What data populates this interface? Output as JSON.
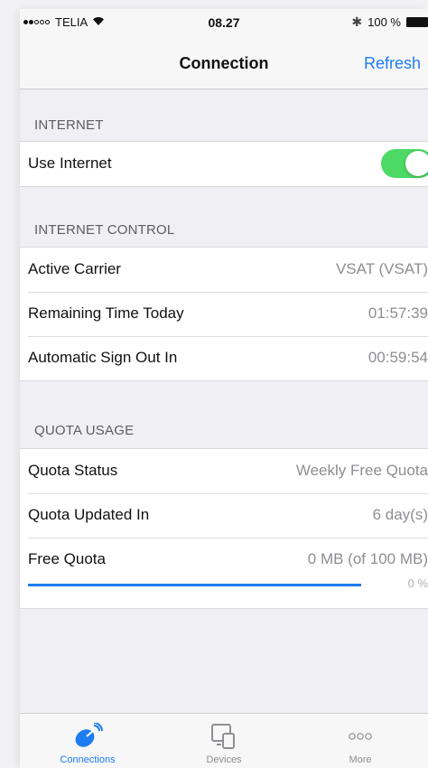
{
  "status_bar": {
    "carrier": "TELIA",
    "time": "08.27",
    "battery": "100 %",
    "signal_icon": "signal-dots-icon",
    "wifi_icon": "wifi-icon",
    "bluetooth_icon": "bluetooth-icon",
    "battery_icon": "battery-icon"
  },
  "nav": {
    "title": "Connection",
    "refresh_label": "Refresh"
  },
  "sections": {
    "internet": {
      "header": "INTERNET",
      "use_internet_label": "Use Internet",
      "use_internet_enabled": true
    },
    "internet_control": {
      "header": "INTERNET CONTROL",
      "rows": [
        {
          "label": "Active Carrier",
          "value": "VSAT (VSAT)"
        },
        {
          "label": "Remaining Time Today",
          "value": "01:57:39"
        },
        {
          "label": "Automatic Sign Out In",
          "value": "00:59:54"
        }
      ]
    },
    "quota_usage": {
      "header": "QUOTA USAGE",
      "rows": [
        {
          "label": "Quota Status",
          "value": "Weekly Free Quota"
        },
        {
          "label": "Quota Updated In",
          "value": "6 day(s)"
        }
      ],
      "free_quota": {
        "label": "Free Quota",
        "value": "0 MB (of 100 MB)",
        "percent_text": "0 %",
        "progress_fraction": 1.0
      }
    }
  },
  "tabs": [
    {
      "label": "Connections",
      "icon": "satellite-dish-icon",
      "active": true
    },
    {
      "label": "Devices",
      "icon": "devices-icon",
      "active": false
    },
    {
      "label": "More",
      "icon": "more-dots-icon",
      "active": false
    }
  ],
  "colors": {
    "accent": "#1d7cf2",
    "toggle_on": "#4cd964"
  }
}
